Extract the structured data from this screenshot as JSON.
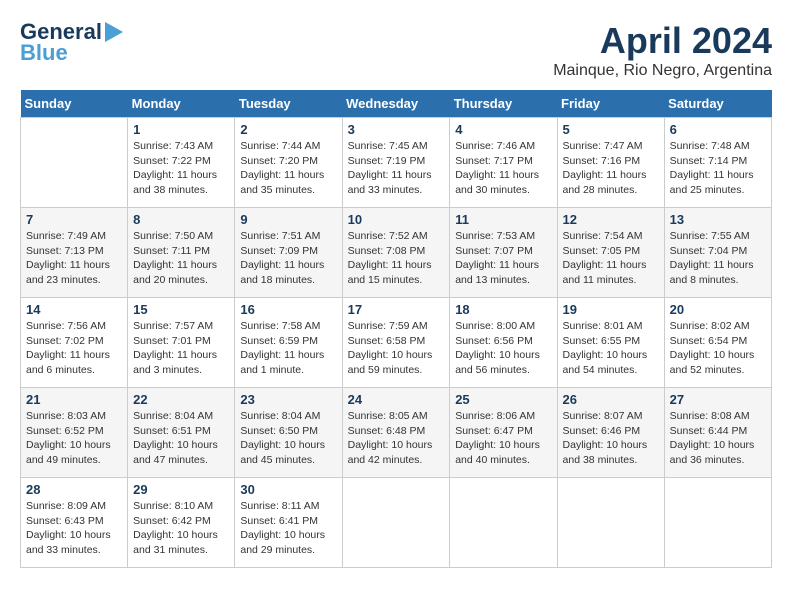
{
  "header": {
    "logo_line1": "General",
    "logo_line2": "Blue",
    "title": "April 2024",
    "subtitle": "Mainque, Rio Negro, Argentina"
  },
  "days_of_week": [
    "Sunday",
    "Monday",
    "Tuesday",
    "Wednesday",
    "Thursday",
    "Friday",
    "Saturday"
  ],
  "weeks": [
    [
      {
        "num": "",
        "info": ""
      },
      {
        "num": "1",
        "info": "Sunrise: 7:43 AM\nSunset: 7:22 PM\nDaylight: 11 hours\nand 38 minutes."
      },
      {
        "num": "2",
        "info": "Sunrise: 7:44 AM\nSunset: 7:20 PM\nDaylight: 11 hours\nand 35 minutes."
      },
      {
        "num": "3",
        "info": "Sunrise: 7:45 AM\nSunset: 7:19 PM\nDaylight: 11 hours\nand 33 minutes."
      },
      {
        "num": "4",
        "info": "Sunrise: 7:46 AM\nSunset: 7:17 PM\nDaylight: 11 hours\nand 30 minutes."
      },
      {
        "num": "5",
        "info": "Sunrise: 7:47 AM\nSunset: 7:16 PM\nDaylight: 11 hours\nand 28 minutes."
      },
      {
        "num": "6",
        "info": "Sunrise: 7:48 AM\nSunset: 7:14 PM\nDaylight: 11 hours\nand 25 minutes."
      }
    ],
    [
      {
        "num": "7",
        "info": "Sunrise: 7:49 AM\nSunset: 7:13 PM\nDaylight: 11 hours\nand 23 minutes."
      },
      {
        "num": "8",
        "info": "Sunrise: 7:50 AM\nSunset: 7:11 PM\nDaylight: 11 hours\nand 20 minutes."
      },
      {
        "num": "9",
        "info": "Sunrise: 7:51 AM\nSunset: 7:09 PM\nDaylight: 11 hours\nand 18 minutes."
      },
      {
        "num": "10",
        "info": "Sunrise: 7:52 AM\nSunset: 7:08 PM\nDaylight: 11 hours\nand 15 minutes."
      },
      {
        "num": "11",
        "info": "Sunrise: 7:53 AM\nSunset: 7:07 PM\nDaylight: 11 hours\nand 13 minutes."
      },
      {
        "num": "12",
        "info": "Sunrise: 7:54 AM\nSunset: 7:05 PM\nDaylight: 11 hours\nand 11 minutes."
      },
      {
        "num": "13",
        "info": "Sunrise: 7:55 AM\nSunset: 7:04 PM\nDaylight: 11 hours\nand 8 minutes."
      }
    ],
    [
      {
        "num": "14",
        "info": "Sunrise: 7:56 AM\nSunset: 7:02 PM\nDaylight: 11 hours\nand 6 minutes."
      },
      {
        "num": "15",
        "info": "Sunrise: 7:57 AM\nSunset: 7:01 PM\nDaylight: 11 hours\nand 3 minutes."
      },
      {
        "num": "16",
        "info": "Sunrise: 7:58 AM\nSunset: 6:59 PM\nDaylight: 11 hours\nand 1 minute."
      },
      {
        "num": "17",
        "info": "Sunrise: 7:59 AM\nSunset: 6:58 PM\nDaylight: 10 hours\nand 59 minutes."
      },
      {
        "num": "18",
        "info": "Sunrise: 8:00 AM\nSunset: 6:56 PM\nDaylight: 10 hours\nand 56 minutes."
      },
      {
        "num": "19",
        "info": "Sunrise: 8:01 AM\nSunset: 6:55 PM\nDaylight: 10 hours\nand 54 minutes."
      },
      {
        "num": "20",
        "info": "Sunrise: 8:02 AM\nSunset: 6:54 PM\nDaylight: 10 hours\nand 52 minutes."
      }
    ],
    [
      {
        "num": "21",
        "info": "Sunrise: 8:03 AM\nSunset: 6:52 PM\nDaylight: 10 hours\nand 49 minutes."
      },
      {
        "num": "22",
        "info": "Sunrise: 8:04 AM\nSunset: 6:51 PM\nDaylight: 10 hours\nand 47 minutes."
      },
      {
        "num": "23",
        "info": "Sunrise: 8:04 AM\nSunset: 6:50 PM\nDaylight: 10 hours\nand 45 minutes."
      },
      {
        "num": "24",
        "info": "Sunrise: 8:05 AM\nSunset: 6:48 PM\nDaylight: 10 hours\nand 42 minutes."
      },
      {
        "num": "25",
        "info": "Sunrise: 8:06 AM\nSunset: 6:47 PM\nDaylight: 10 hours\nand 40 minutes."
      },
      {
        "num": "26",
        "info": "Sunrise: 8:07 AM\nSunset: 6:46 PM\nDaylight: 10 hours\nand 38 minutes."
      },
      {
        "num": "27",
        "info": "Sunrise: 8:08 AM\nSunset: 6:44 PM\nDaylight: 10 hours\nand 36 minutes."
      }
    ],
    [
      {
        "num": "28",
        "info": "Sunrise: 8:09 AM\nSunset: 6:43 PM\nDaylight: 10 hours\nand 33 minutes."
      },
      {
        "num": "29",
        "info": "Sunrise: 8:10 AM\nSunset: 6:42 PM\nDaylight: 10 hours\nand 31 minutes."
      },
      {
        "num": "30",
        "info": "Sunrise: 8:11 AM\nSunset: 6:41 PM\nDaylight: 10 hours\nand 29 minutes."
      },
      {
        "num": "",
        "info": ""
      },
      {
        "num": "",
        "info": ""
      },
      {
        "num": "",
        "info": ""
      },
      {
        "num": "",
        "info": ""
      }
    ]
  ]
}
